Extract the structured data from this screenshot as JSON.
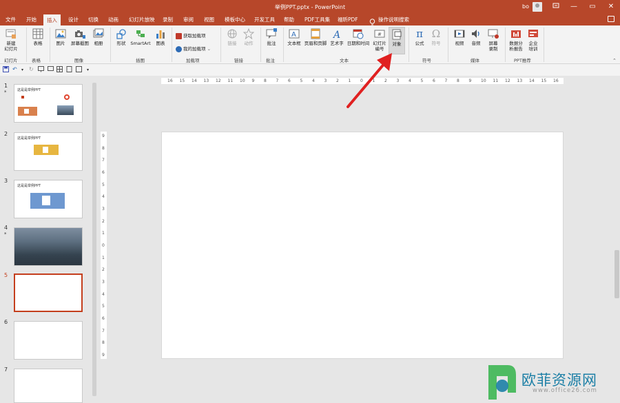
{
  "window": {
    "title": "举例PPT.pptx - PowerPoint",
    "user": "bo",
    "minimize": "—",
    "restore": "▭",
    "close": "✕"
  },
  "tabs": [
    "文件",
    "开始",
    "插入",
    "设计",
    "切换",
    "动画",
    "幻灯片放映",
    "录制",
    "审阅",
    "视图",
    "模板中心",
    "开发工具",
    "帮助",
    "PDF工具集",
    "福昕PDF"
  ],
  "active_tab": "插入",
  "tell_me": "操作说明搜索",
  "ribbon": {
    "new_slide": "新建\n幻灯片",
    "table": "表格",
    "picture": "图片",
    "screenshot": "屏幕截图",
    "album": "相册",
    "shapes": "形状",
    "smartart": "SmartArt",
    "chart": "图表",
    "get_addins": "获取加载项",
    "my_addins": "我的加载项",
    "link": "链接",
    "action": "动作",
    "comment": "批注",
    "textbox": "文本框",
    "header_footer": "页眉和页脚",
    "wordart": "艺术字",
    "datetime": "日期和时间",
    "slide_number": "幻灯片\n编号",
    "object": "对象",
    "equation": "公式",
    "symbol": "符号",
    "video": "视频",
    "audio": "音频",
    "screen_record": "屏幕\n录制",
    "data_report": "数据分\n析报告",
    "enterprise_training": "企业\n培训",
    "groups": {
      "slides": "幻灯片",
      "tables": "表格",
      "images": "图像",
      "illustrations": "插图",
      "addins": "加载项",
      "links": "链接",
      "comments": "批注",
      "text": "文本",
      "symbols": "符号",
      "media": "媒体",
      "ppt_recommend": "PPT推荐"
    }
  },
  "thumbnails": [
    {
      "num": "1",
      "star": "*",
      "title": "这是是举例PPT"
    },
    {
      "num": "2",
      "star": "",
      "title": "这是是举例PPT"
    },
    {
      "num": "3",
      "star": "",
      "title": "这是是举例PPT"
    },
    {
      "num": "4",
      "star": "*",
      "title": ""
    },
    {
      "num": "5",
      "star": "",
      "title": ""
    },
    {
      "num": "6",
      "star": "",
      "title": ""
    },
    {
      "num": "7",
      "star": "",
      "title": ""
    }
  ],
  "ruler": {
    "horizontal": [
      "16",
      "15",
      "14",
      "13",
      "12",
      "11",
      "10",
      "9",
      "8",
      "7",
      "6",
      "5",
      "4",
      "3",
      "2",
      "1",
      "0",
      "1",
      "2",
      "3",
      "4",
      "5",
      "6",
      "7",
      "8",
      "9",
      "10",
      "11",
      "12",
      "13",
      "14",
      "15",
      "16"
    ],
    "vertical": [
      "9",
      "8",
      "7",
      "6",
      "5",
      "4",
      "3",
      "2",
      "1",
      "0",
      "1",
      "2",
      "3",
      "4",
      "5",
      "6",
      "7",
      "8",
      "9"
    ]
  },
  "watermark": {
    "text": "欧菲资源网",
    "url": "www.office26.com"
  },
  "colors": {
    "accent": "#b7472a",
    "arrow": "#e02020",
    "selected_slide": "#c43e1c"
  }
}
